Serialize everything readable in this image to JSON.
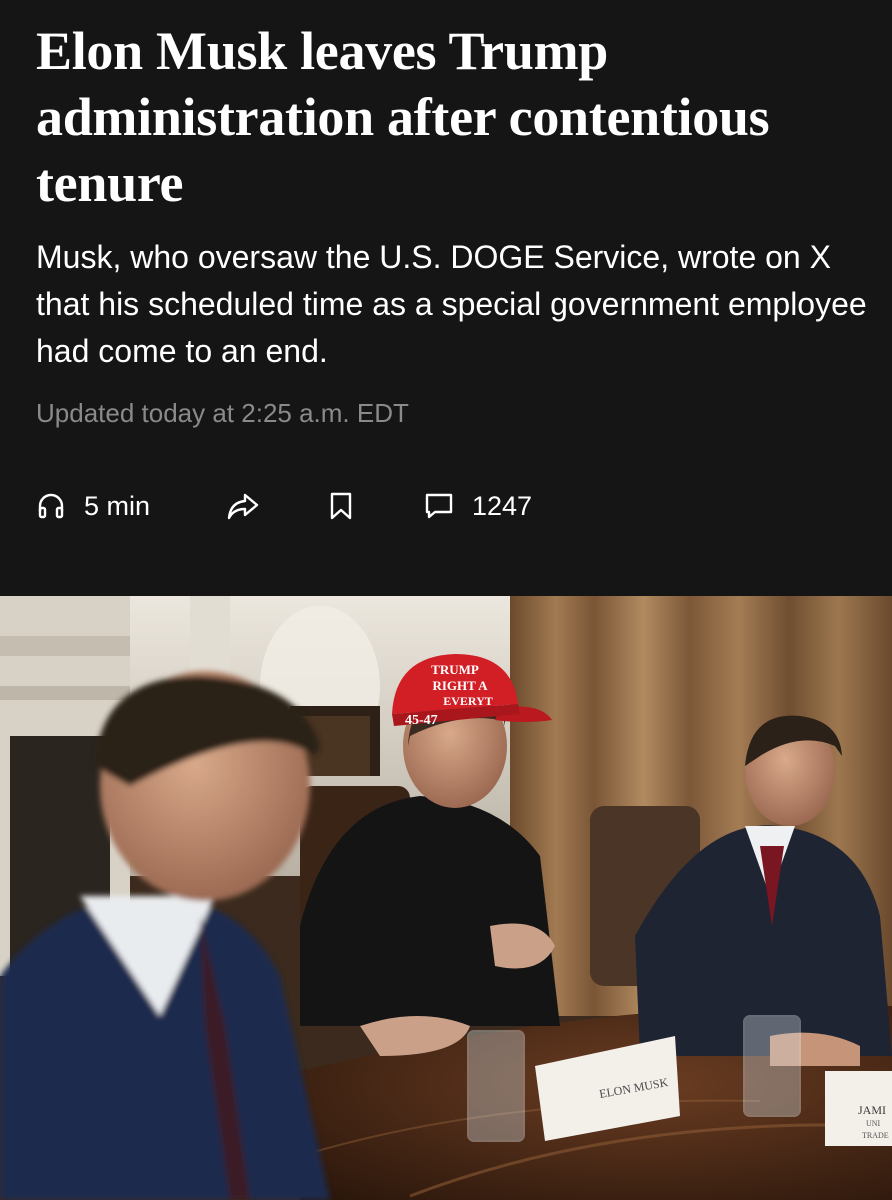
{
  "article": {
    "headline": "Elon Musk leaves Trump administration after contentious tenure",
    "dek": "Musk, who oversaw the U.S. DOGE Service, wrote on X that his scheduled time as a special government employee had come to an end.",
    "timestamp": "Updated today at 2:25 a.m. EDT"
  },
  "actions": {
    "listen_label": "5 min",
    "comments_count": "1247",
    "icons": {
      "listen": "headphones-icon",
      "share": "share-arrow-icon",
      "save": "bookmark-icon",
      "comments": "comment-bubble-icon"
    }
  },
  "photo": {
    "hat_text": [
      "TRUMP",
      "RIGHT A",
      "EVERYT"
    ],
    "hat_side": "45-47",
    "nameplate_musk": "ELON MUSK",
    "nameplate_right": [
      "JAMI",
      "UNI",
      "TRADE"
    ]
  },
  "colors": {
    "background": "#151515",
    "text": "#ffffff",
    "muted": "#8a8a8a",
    "hat_red": "#d21f26"
  }
}
